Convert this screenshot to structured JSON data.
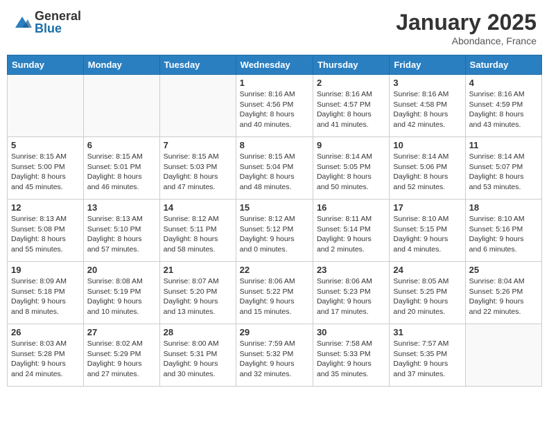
{
  "header": {
    "logo_general": "General",
    "logo_blue": "Blue",
    "month_title": "January 2025",
    "location": "Abondance, France"
  },
  "weekdays": [
    "Sunday",
    "Monday",
    "Tuesday",
    "Wednesday",
    "Thursday",
    "Friday",
    "Saturday"
  ],
  "weeks": [
    [
      {
        "day": "",
        "info": ""
      },
      {
        "day": "",
        "info": ""
      },
      {
        "day": "",
        "info": ""
      },
      {
        "day": "1",
        "info": "Sunrise: 8:16 AM\nSunset: 4:56 PM\nDaylight: 8 hours\nand 40 minutes."
      },
      {
        "day": "2",
        "info": "Sunrise: 8:16 AM\nSunset: 4:57 PM\nDaylight: 8 hours\nand 41 minutes."
      },
      {
        "day": "3",
        "info": "Sunrise: 8:16 AM\nSunset: 4:58 PM\nDaylight: 8 hours\nand 42 minutes."
      },
      {
        "day": "4",
        "info": "Sunrise: 8:16 AM\nSunset: 4:59 PM\nDaylight: 8 hours\nand 43 minutes."
      }
    ],
    [
      {
        "day": "5",
        "info": "Sunrise: 8:15 AM\nSunset: 5:00 PM\nDaylight: 8 hours\nand 45 minutes."
      },
      {
        "day": "6",
        "info": "Sunrise: 8:15 AM\nSunset: 5:01 PM\nDaylight: 8 hours\nand 46 minutes."
      },
      {
        "day": "7",
        "info": "Sunrise: 8:15 AM\nSunset: 5:03 PM\nDaylight: 8 hours\nand 47 minutes."
      },
      {
        "day": "8",
        "info": "Sunrise: 8:15 AM\nSunset: 5:04 PM\nDaylight: 8 hours\nand 48 minutes."
      },
      {
        "day": "9",
        "info": "Sunrise: 8:14 AM\nSunset: 5:05 PM\nDaylight: 8 hours\nand 50 minutes."
      },
      {
        "day": "10",
        "info": "Sunrise: 8:14 AM\nSunset: 5:06 PM\nDaylight: 8 hours\nand 52 minutes."
      },
      {
        "day": "11",
        "info": "Sunrise: 8:14 AM\nSunset: 5:07 PM\nDaylight: 8 hours\nand 53 minutes."
      }
    ],
    [
      {
        "day": "12",
        "info": "Sunrise: 8:13 AM\nSunset: 5:08 PM\nDaylight: 8 hours\nand 55 minutes."
      },
      {
        "day": "13",
        "info": "Sunrise: 8:13 AM\nSunset: 5:10 PM\nDaylight: 8 hours\nand 57 minutes."
      },
      {
        "day": "14",
        "info": "Sunrise: 8:12 AM\nSunset: 5:11 PM\nDaylight: 8 hours\nand 58 minutes."
      },
      {
        "day": "15",
        "info": "Sunrise: 8:12 AM\nSunset: 5:12 PM\nDaylight: 9 hours\nand 0 minutes."
      },
      {
        "day": "16",
        "info": "Sunrise: 8:11 AM\nSunset: 5:14 PM\nDaylight: 9 hours\nand 2 minutes."
      },
      {
        "day": "17",
        "info": "Sunrise: 8:10 AM\nSunset: 5:15 PM\nDaylight: 9 hours\nand 4 minutes."
      },
      {
        "day": "18",
        "info": "Sunrise: 8:10 AM\nSunset: 5:16 PM\nDaylight: 9 hours\nand 6 minutes."
      }
    ],
    [
      {
        "day": "19",
        "info": "Sunrise: 8:09 AM\nSunset: 5:18 PM\nDaylight: 9 hours\nand 8 minutes."
      },
      {
        "day": "20",
        "info": "Sunrise: 8:08 AM\nSunset: 5:19 PM\nDaylight: 9 hours\nand 10 minutes."
      },
      {
        "day": "21",
        "info": "Sunrise: 8:07 AM\nSunset: 5:20 PM\nDaylight: 9 hours\nand 13 minutes."
      },
      {
        "day": "22",
        "info": "Sunrise: 8:06 AM\nSunset: 5:22 PM\nDaylight: 9 hours\nand 15 minutes."
      },
      {
        "day": "23",
        "info": "Sunrise: 8:06 AM\nSunset: 5:23 PM\nDaylight: 9 hours\nand 17 minutes."
      },
      {
        "day": "24",
        "info": "Sunrise: 8:05 AM\nSunset: 5:25 PM\nDaylight: 9 hours\nand 20 minutes."
      },
      {
        "day": "25",
        "info": "Sunrise: 8:04 AM\nSunset: 5:26 PM\nDaylight: 9 hours\nand 22 minutes."
      }
    ],
    [
      {
        "day": "26",
        "info": "Sunrise: 8:03 AM\nSunset: 5:28 PM\nDaylight: 9 hours\nand 24 minutes."
      },
      {
        "day": "27",
        "info": "Sunrise: 8:02 AM\nSunset: 5:29 PM\nDaylight: 9 hours\nand 27 minutes."
      },
      {
        "day": "28",
        "info": "Sunrise: 8:00 AM\nSunset: 5:31 PM\nDaylight: 9 hours\nand 30 minutes."
      },
      {
        "day": "29",
        "info": "Sunrise: 7:59 AM\nSunset: 5:32 PM\nDaylight: 9 hours\nand 32 minutes."
      },
      {
        "day": "30",
        "info": "Sunrise: 7:58 AM\nSunset: 5:33 PM\nDaylight: 9 hours\nand 35 minutes."
      },
      {
        "day": "31",
        "info": "Sunrise: 7:57 AM\nSunset: 5:35 PM\nDaylight: 9 hours\nand 37 minutes."
      },
      {
        "day": "",
        "info": ""
      }
    ]
  ]
}
